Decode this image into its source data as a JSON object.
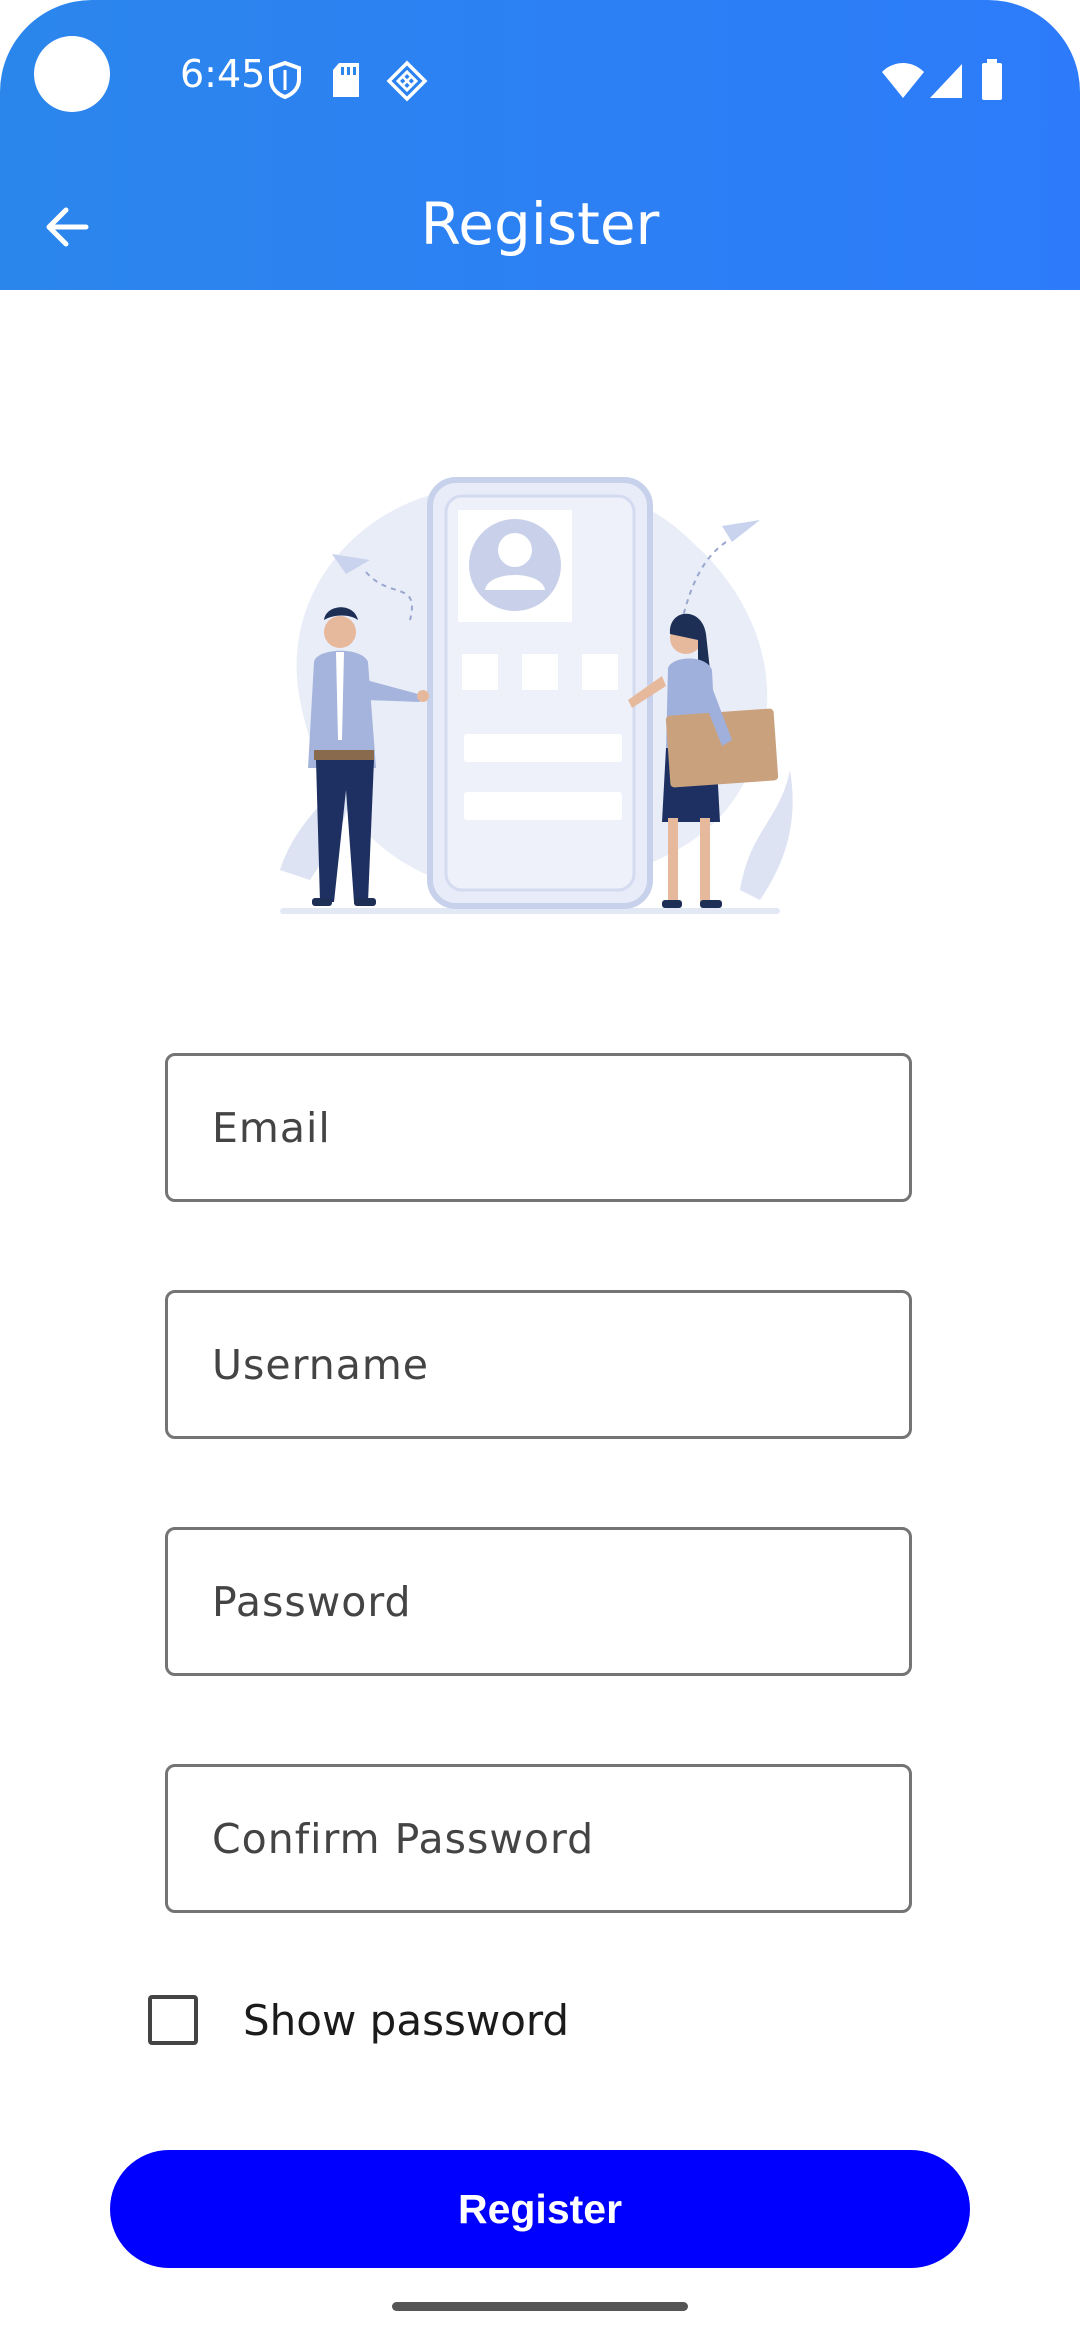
{
  "status_bar": {
    "time": "6:45",
    "icons": [
      "shield-icon",
      "sd-card-icon",
      "diamond-grid-icon",
      "wifi-icon",
      "signal-icon",
      "battery-icon"
    ]
  },
  "header": {
    "title": "Register",
    "back_icon": "back-arrow-icon",
    "gradient_colors": [
      "#2b86ec",
      "#2d7bfa"
    ]
  },
  "form": {
    "fields": [
      {
        "label": "Email"
      },
      {
        "label": "Username"
      },
      {
        "label": "Password"
      },
      {
        "label": "Confirm Password"
      }
    ],
    "show_password_label": "Show password",
    "show_password_checked": false,
    "submit_label": "Register",
    "submit_color": "#0000ff"
  }
}
